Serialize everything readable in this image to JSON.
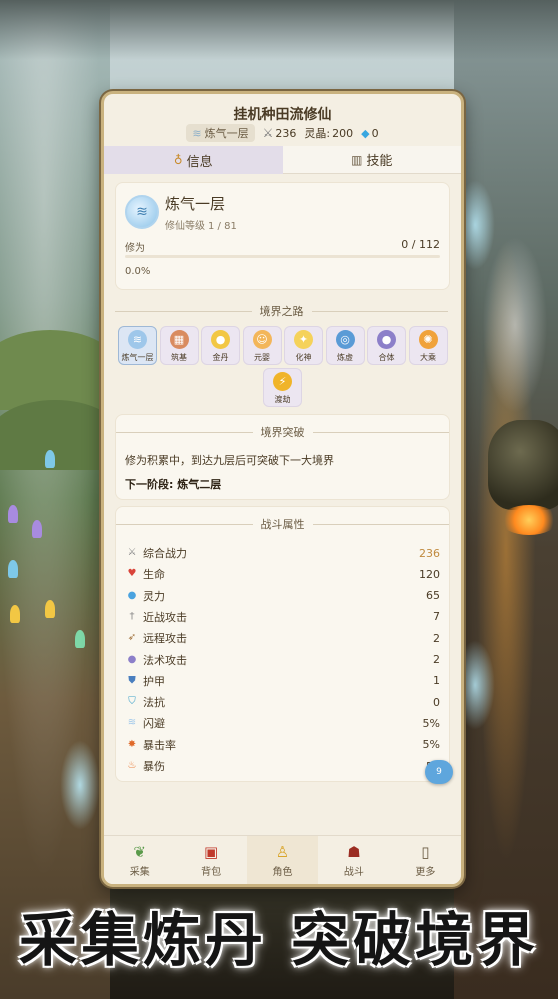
{
  "app": {
    "title": "挂机种田流修仙"
  },
  "header_stats": {
    "realm": "炼气一层",
    "combat_power": "236",
    "spirit_crystal_label": "灵晶:",
    "spirit_crystal_value": "200",
    "gems": "0"
  },
  "tabs": [
    {
      "label": "信息",
      "icon": "gourd-icon",
      "active": true
    },
    {
      "label": "技能",
      "icon": "chart-icon",
      "active": false
    }
  ],
  "realm_card": {
    "name": "炼气一层",
    "level_label": "修仙等级",
    "level_value": "1 / 81",
    "cultivation_label": "修为",
    "cultivation_value": "0 / 112",
    "cultivation_fraction": 0.0,
    "cultivation_percent": "0.0%"
  },
  "realm_path": {
    "title": "境界之路",
    "stages": [
      {
        "name": "炼气一层",
        "icon": "wind-icon",
        "color": "#9ec7ea",
        "current": true
      },
      {
        "name": "筑基",
        "icon": "brick-icon",
        "color": "#d98b5f",
        "current": false
      },
      {
        "name": "金丹",
        "icon": "golden-core-icon",
        "color": "#f2c744",
        "current": false
      },
      {
        "name": "元婴",
        "icon": "infant-icon",
        "color": "#f3b65a",
        "current": false
      },
      {
        "name": "化神",
        "icon": "sparkle-icon",
        "color": "#f5d25a",
        "current": false
      },
      {
        "name": "炼虚",
        "icon": "swirl-icon",
        "color": "#5a9bd6",
        "current": false
      },
      {
        "name": "合体",
        "icon": "orb-icon",
        "color": "#8c7fc9",
        "current": false
      },
      {
        "name": "大乘",
        "icon": "sun-icon",
        "color": "#f0a23a",
        "current": false
      },
      {
        "name": "渡劫",
        "icon": "lightning-icon",
        "color": "#f0b429",
        "current": false
      }
    ]
  },
  "breakthrough": {
    "title": "境界突破",
    "description": "修为积累中，到达九层后可突破下一大境界",
    "next_stage": "下一阶段: 炼气二层"
  },
  "combat_attributes": {
    "title": "战斗属性",
    "items": [
      {
        "label": "综合战力",
        "value": "236",
        "icon": "swords-icon",
        "icon_color": "#8a8a8a",
        "highlight": true
      },
      {
        "label": "生命",
        "value": "120",
        "icon": "heart-icon",
        "icon_color": "#d9443a",
        "highlight": false
      },
      {
        "label": "灵力",
        "value": "65",
        "icon": "droplet-icon",
        "icon_color": "#4aa3df",
        "highlight": false
      },
      {
        "label": "近战攻击",
        "value": "7",
        "icon": "sword-icon",
        "icon_color": "#8a8a8a",
        "highlight": false
      },
      {
        "label": "远程攻击",
        "value": "2",
        "icon": "bow-icon",
        "icon_color": "#a0703a",
        "highlight": false
      },
      {
        "label": "法术攻击",
        "value": "2",
        "icon": "crystal-ball-icon",
        "icon_color": "#8c7fc9",
        "highlight": false
      },
      {
        "label": "护甲",
        "value": "1",
        "icon": "shield-icon",
        "icon_color": "#4a7fbf",
        "highlight": false
      },
      {
        "label": "法抗",
        "value": "0",
        "icon": "magic-shield-icon",
        "icon_color": "#3aa0c9",
        "highlight": false
      },
      {
        "label": "闪避",
        "value": "5%",
        "icon": "dodge-icon",
        "icon_color": "#9ec7ea",
        "highlight": false
      },
      {
        "label": "暴击率",
        "value": "5%",
        "icon": "burst-icon",
        "icon_color": "#e06a2a",
        "highlight": false
      },
      {
        "label": "暴伤",
        "value": "50",
        "icon": "flame-icon",
        "icon_color": "#e8702a",
        "highlight": false
      }
    ]
  },
  "float_badge": "9",
  "bottom_nav": [
    {
      "label": "采集",
      "icon": "sprout-icon",
      "active": false
    },
    {
      "label": "背包",
      "icon": "bag-icon",
      "active": false
    },
    {
      "label": "角色",
      "icon": "character-icon",
      "active": true
    },
    {
      "label": "战斗",
      "icon": "demon-mask-icon",
      "active": false
    },
    {
      "label": "更多",
      "icon": "scroll-icon",
      "active": false
    }
  ],
  "slogan": "采集炼丹 突破境界"
}
